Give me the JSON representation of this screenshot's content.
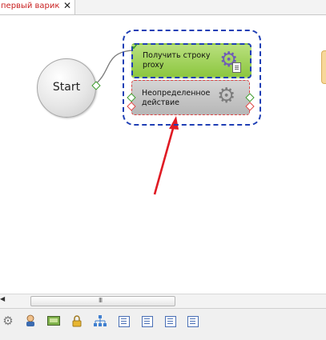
{
  "tab": {
    "title": "первый варик",
    "close": "✕"
  },
  "canvas": {
    "start_node": {
      "label": "Start"
    },
    "green_node": {
      "line1": "Получить строку",
      "line2": "proxy"
    },
    "grey_node": {
      "line1": "Неопределенное",
      "line2": "действие"
    }
  },
  "scrollbar": {
    "left_arrow": "◀",
    "grip": "III"
  },
  "toolbar": {
    "tools": [
      "gear-icon",
      "user-icon",
      "image-icon",
      "lock-icon",
      "hierarchy-icon",
      "list-icon",
      "list-icon",
      "list-icon",
      "list-icon"
    ]
  },
  "colors": {
    "accent_tab_text": "#c81e1e",
    "group_border": "#1f3fb5",
    "green_node": "#8cc63f",
    "grey_node": "#b7b7b7",
    "arrow": "#e01b24",
    "connector": "#7a7a7a"
  }
}
